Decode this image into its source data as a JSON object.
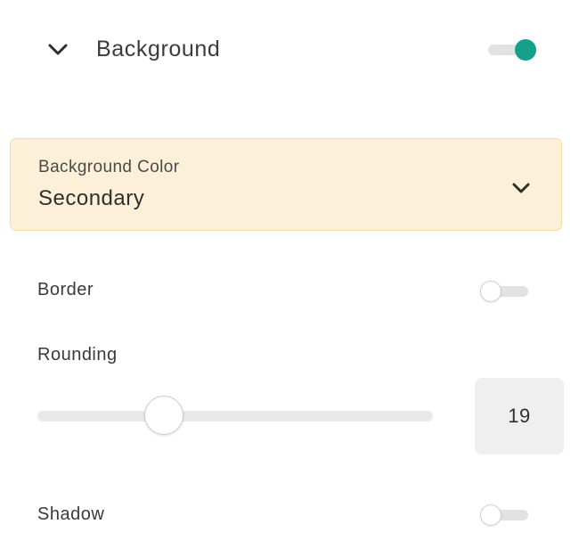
{
  "background_section": {
    "title": "Background",
    "enabled": true,
    "collapse_icon": "chevron-down-icon"
  },
  "background_color": {
    "label": "Background Color",
    "value": "Secondary",
    "dropdown_icon": "chevron-down-icon"
  },
  "border": {
    "label": "Border",
    "enabled": false
  },
  "rounding": {
    "label": "Rounding",
    "value": "19",
    "slider_min": 0,
    "slider_max": 64,
    "slider_fraction": 0.32
  },
  "shadow": {
    "label": "Shadow",
    "enabled": false
  },
  "colors": {
    "accent": "#14a08b",
    "select_bg": "#fdf0d8",
    "select_border": "#f3dca6",
    "track": "#e2e2e2",
    "number_box_bg": "#efefef"
  }
}
